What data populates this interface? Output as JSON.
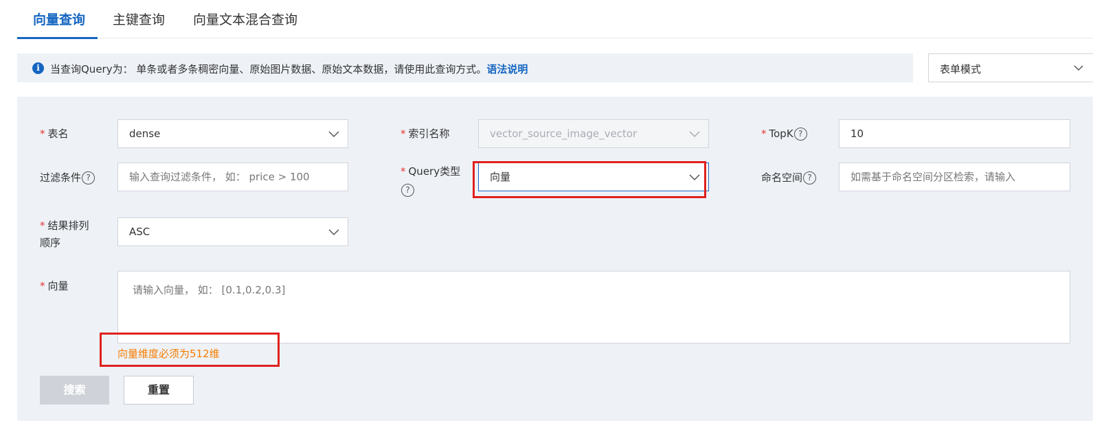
{
  "tabs": [
    {
      "label": "向量查询",
      "active": true
    },
    {
      "label": "主键查询",
      "active": false
    },
    {
      "label": "向量文本混合查询",
      "active": false
    }
  ],
  "info": {
    "text": "当查询Query为： 单条或者多条稠密向量、原始图片数据、原始文本数据，请使用此查询方式。",
    "link": "语法说明",
    "icon": "info-icon"
  },
  "mode_select": {
    "value": "表单模式"
  },
  "form": {
    "table": {
      "label": "表名",
      "value": "dense"
    },
    "index": {
      "label": "索引名称",
      "value": "vector_source_image_vector"
    },
    "topk": {
      "label": "TopK",
      "value": "10"
    },
    "filter": {
      "label": "过滤条件",
      "placeholder": "输入查询过滤条件， 如： price > 100"
    },
    "query_type": {
      "label": "Query类型",
      "value": "向量"
    },
    "namespace": {
      "label": "命名空间",
      "placeholder": "如需基于命名空间分区检索，请输入"
    },
    "sort_order": {
      "label_line1": "结果排列",
      "label_line2": "顺序",
      "value": "ASC"
    },
    "vector": {
      "label": "向量",
      "placeholder": "请输入向量， 如： [0.1,0.2,0.3]"
    },
    "error": "向量维度必须为512维"
  },
  "buttons": {
    "search": "搜索",
    "reset": "重置"
  },
  "colors": {
    "accent": "#1565c0",
    "required_star": "#e53935",
    "error": "#f57c00",
    "highlight_box": "#e0201c",
    "panel_bg": "#eef2f7"
  }
}
